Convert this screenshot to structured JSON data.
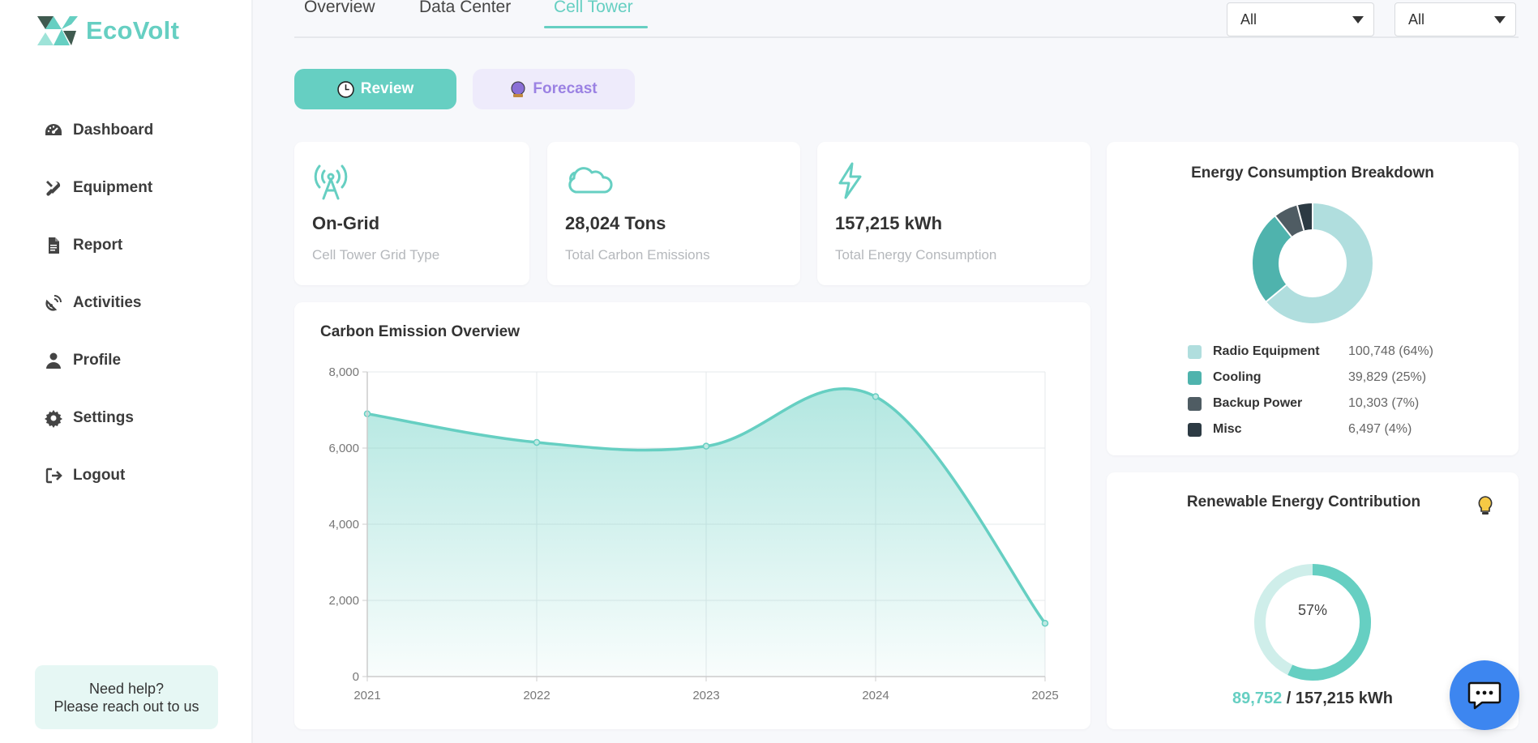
{
  "brand": {
    "name": "EcoVolt"
  },
  "sidebar": {
    "items": [
      {
        "label": "Dashboard",
        "icon": "gauge-icon"
      },
      {
        "label": "Equipment",
        "icon": "tools-icon"
      },
      {
        "label": "Report",
        "icon": "document-icon"
      },
      {
        "label": "Activities",
        "icon": "satellite-icon"
      },
      {
        "label": "Profile",
        "icon": "user-icon"
      },
      {
        "label": "Settings",
        "icon": "gear-icon"
      },
      {
        "label": "Logout",
        "icon": "logout-icon"
      }
    ],
    "help_line1": "Need help?",
    "help_line2": "Please reach out to us"
  },
  "tabs": [
    {
      "label": "Overview",
      "active": false
    },
    {
      "label": "Data Center",
      "active": false
    },
    {
      "label": "Cell Tower",
      "active": true
    }
  ],
  "filters": [
    {
      "value": "All"
    },
    {
      "value": "All"
    }
  ],
  "mode_buttons": {
    "review": "Review",
    "forecast": "Forecast"
  },
  "stats": [
    {
      "value": "On-Grid",
      "label": "Cell Tower Grid Type",
      "icon": "antenna-icon"
    },
    {
      "value": "28,024 Tons",
      "label": "Total Carbon Emissions",
      "icon": "cloud-icon"
    },
    {
      "value": "157,215 kWh",
      "label": "Total Energy Consumption",
      "icon": "lightning-icon"
    }
  ],
  "emission_chart": {
    "title": "Carbon Emission Overview",
    "chart_data": {
      "type": "area",
      "x": [
        "2021",
        "2022",
        "2023",
        "2024",
        "2025"
      ],
      "series": [
        {
          "values": [
            6900,
            6150,
            6050,
            7350,
            1400
          ]
        }
      ],
      "ylim": [
        0,
        8000
      ],
      "yticks": [
        "0",
        "2,000",
        "4,000",
        "6,000",
        "8,000"
      ],
      "grid": true,
      "color": "#66cfc2"
    }
  },
  "breakdown": {
    "title": "Energy Consumption Breakdown",
    "chart_data": {
      "type": "pie",
      "categories": [
        "Radio Equipment",
        "Cooling",
        "Backup Power",
        "Misc"
      ],
      "values": [
        100748,
        39829,
        10303,
        6497
      ],
      "display_values": [
        "100,748 (64%)",
        "39,829 (25%)",
        "10,303 (7%)",
        "6,497 (4%)"
      ],
      "colors": [
        "#b0dede",
        "#4fb3ad",
        "#4f5c63",
        "#2c3a43"
      ]
    }
  },
  "renewable": {
    "title": "Renewable Energy Contribution",
    "percent_label": "57%",
    "fraction": 0.57,
    "amount": "89,752",
    "total": "/ 157,215 kWh",
    "hint_icon": "lightbulb-icon"
  },
  "colors": {
    "accent": "#66cfc2",
    "chat": "#3d86f0",
    "forecast": "#9b82e3"
  }
}
